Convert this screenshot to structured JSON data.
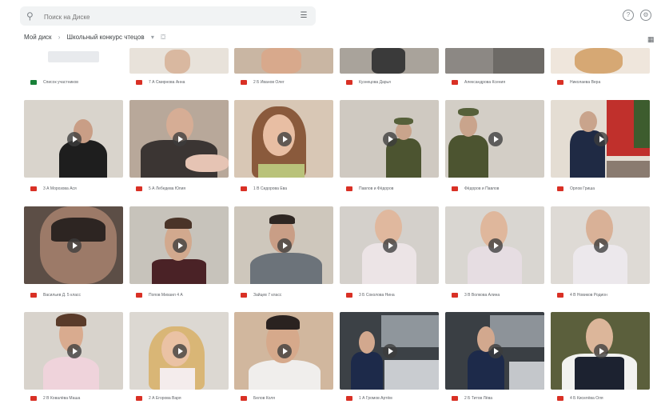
{
  "search": {
    "placeholder": "Поиск на Диске"
  },
  "breadcrumb": {
    "root": "Мой диск",
    "folder": "Школьный конкурс чтецов"
  },
  "files": [
    {
      "name": "Список участников",
      "kind": "sheet"
    },
    {
      "name": "7 А Смирнова Анна",
      "kind": "video"
    },
    {
      "name": "2 Б Иванов Олег",
      "kind": "video"
    },
    {
      "name": "Кузнецова Дарья",
      "kind": "video"
    },
    {
      "name": "Александрова Ксения",
      "kind": "video"
    },
    {
      "name": "Николаева Вера",
      "kind": "video"
    },
    {
      "name": "3 А Морозова Ася",
      "kind": "video"
    },
    {
      "name": "5 А Лебедева Юлия",
      "kind": "video"
    },
    {
      "name": "1 В Сидорова Ева",
      "kind": "video"
    },
    {
      "name": "Павлов и Фёдоров",
      "kind": "video"
    },
    {
      "name": "Фёдоров и Павлов",
      "kind": "video"
    },
    {
      "name": "Орлов Гриша",
      "kind": "video"
    },
    {
      "name": "Васильев Д. 5 класс",
      "kind": "video"
    },
    {
      "name": "Попов Михаил 4 А",
      "kind": "video"
    },
    {
      "name": "Зайцев 7 класс",
      "kind": "video"
    },
    {
      "name": "3 Б Соколова Нина",
      "kind": "video"
    },
    {
      "name": "3 В Волкова Алина",
      "kind": "video"
    },
    {
      "name": "4 В Новиков Родион",
      "kind": "video"
    },
    {
      "name": "2 В Ковалёва Маша",
      "kind": "video"
    },
    {
      "name": "2 А Егорова Варя",
      "kind": "video"
    },
    {
      "name": "Белов Коля",
      "kind": "video"
    },
    {
      "name": "1 А Громов Артём",
      "kind": "video"
    },
    {
      "name": "2 Б Титов Лёва",
      "kind": "video"
    },
    {
      "name": "4 Б Киселёва Оля",
      "kind": "video"
    }
  ]
}
